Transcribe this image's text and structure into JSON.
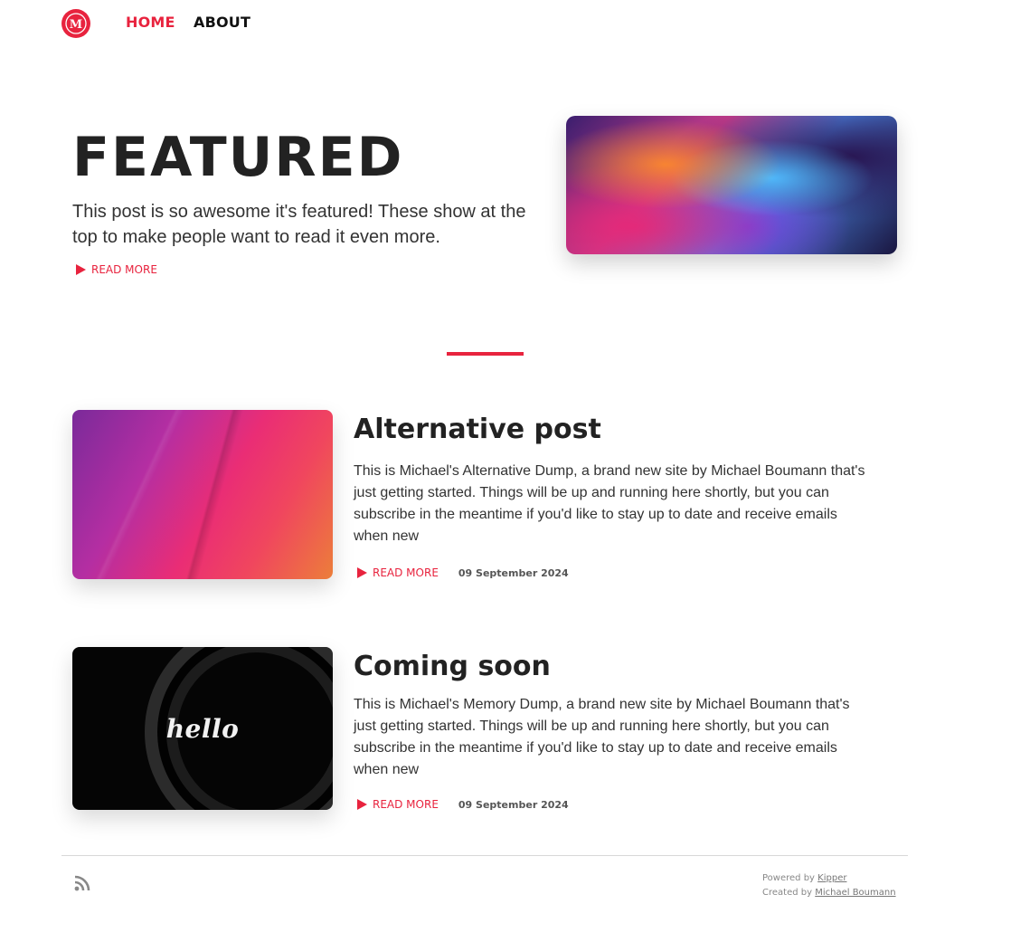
{
  "nav": {
    "logo_letter": "M",
    "links": [
      "HOME",
      "ABOUT"
    ]
  },
  "featured": {
    "title": "FEATURED",
    "description": "This post is so awesome it's featured! These show at the top to make people want to read it even more.",
    "read_more": "READ MORE"
  },
  "posts": [
    {
      "title": "Alternative post",
      "excerpt": "This is Michael's Alternative Dump, a brand new site by Michael Boumann that's just getting started. Things will be up and running here shortly, but you can subscribe in the meantime if you'd like to stay up to date and receive emails when new",
      "read_more": "READ MORE",
      "date": "09 September 2024"
    },
    {
      "title": "Coming soon",
      "excerpt": "This is Michael's Memory Dump, a brand new site by Michael Boumann that's just getting started. Things will be up and running here shortly, but you can subscribe in the meantime if you'd like to stay up to date and receive emails when new",
      "read_more": "READ MORE",
      "date": "09 September 2024",
      "image_text": "hello"
    }
  ],
  "footer": {
    "powered_label": "Powered by",
    "powered_link": "Kipper",
    "created_label": "Created by",
    "created_link": "Michael Boumann"
  },
  "colors": {
    "accent": "#e8233e",
    "text": "#222222"
  },
  "icons": [
    "logo-icon",
    "play-icon",
    "rss-icon"
  ]
}
